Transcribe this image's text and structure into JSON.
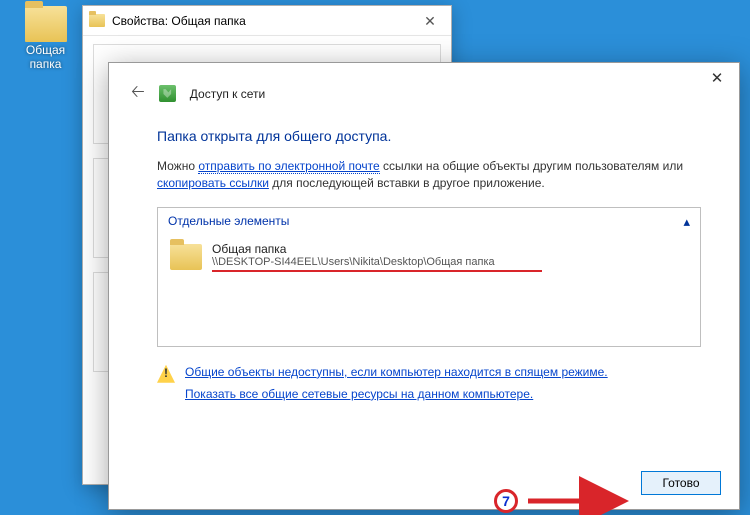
{
  "desktop": {
    "folder_label": "Общая папка"
  },
  "properties": {
    "title": "Свойства: Общая папка"
  },
  "networkAccess": {
    "headTitle": "Доступ к сети",
    "heading": "Папка открыта для общего доступа.",
    "desc_prefix": "Можно ",
    "desc_link_email": "отправить по электронной почте",
    "desc_mid": " ссылки на общие объекты другим пользователям или ",
    "desc_link_copy": "скопировать ссылки",
    "desc_suffix": " для последующей вставки в другое приложение.",
    "group_legend": "Отдельные элементы",
    "item_name": "Общая папка",
    "item_path": "\\\\DESKTOP-SI44EEL\\Users\\Nikita\\Desktop\\Общая папка",
    "link_sleep": "Общие объекты недоступны, если компьютер находится в спящем режиме.",
    "link_showall": "Показать все общие сетевые ресурсы на данном компьютере.",
    "btn_done": "Готово"
  },
  "annotation": {
    "step": "7"
  }
}
